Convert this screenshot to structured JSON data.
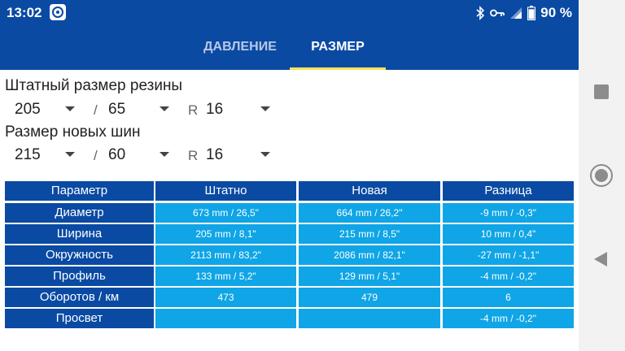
{
  "status_bar": {
    "time": "13:02",
    "battery_label": "90 %",
    "battery_level": 0.9,
    "icons": [
      "app-icon",
      "bluetooth-icon",
      "key-icon",
      "signal-icon",
      "battery-icon"
    ]
  },
  "tabs": [
    {
      "label": "ДАВЛЕНИЕ",
      "active": false
    },
    {
      "label": "РАЗМЕР",
      "active": true
    }
  ],
  "stock": {
    "label": "Штатный размер резины",
    "width": "205",
    "sep": "/",
    "profile": "65",
    "r": "R",
    "rim": "16"
  },
  "new": {
    "label": "Размер новых шин",
    "width": "215",
    "sep": "/",
    "profile": "60",
    "r": "R",
    "rim": "16"
  },
  "table": {
    "headers": [
      "Параметр",
      "Штатно",
      "Новая",
      "Разница"
    ],
    "rows": [
      {
        "param": "Диаметр",
        "stock": "673 mm / 26,5\"",
        "new": "664 mm / 26,2\"",
        "diff": "-9 mm / -0,3\""
      },
      {
        "param": "Ширина",
        "stock": "205 mm / 8,1\"",
        "new": "215 mm / 8,5\"",
        "diff": "10 mm / 0,4\""
      },
      {
        "param": "Окружность",
        "stock": "2113 mm / 83,2\"",
        "new": "2086 mm / 82,1\"",
        "diff": "-27 mm / -1,1\""
      },
      {
        "param": "Профиль",
        "stock": "133 mm / 5,2\"",
        "new": "129 mm / 5,1\"",
        "diff": "-4 mm / -0,2\""
      },
      {
        "param": "Оборотов / км",
        "stock": "473",
        "new": "479",
        "diff": "6"
      },
      {
        "param": "Просвет",
        "stock": "",
        "new": "",
        "diff": "-4 mm / -0,2\""
      }
    ]
  },
  "colors": {
    "primary": "#0a4aa3",
    "cell": "#0fa5e6",
    "tab_indicator": "#f3e35a"
  }
}
